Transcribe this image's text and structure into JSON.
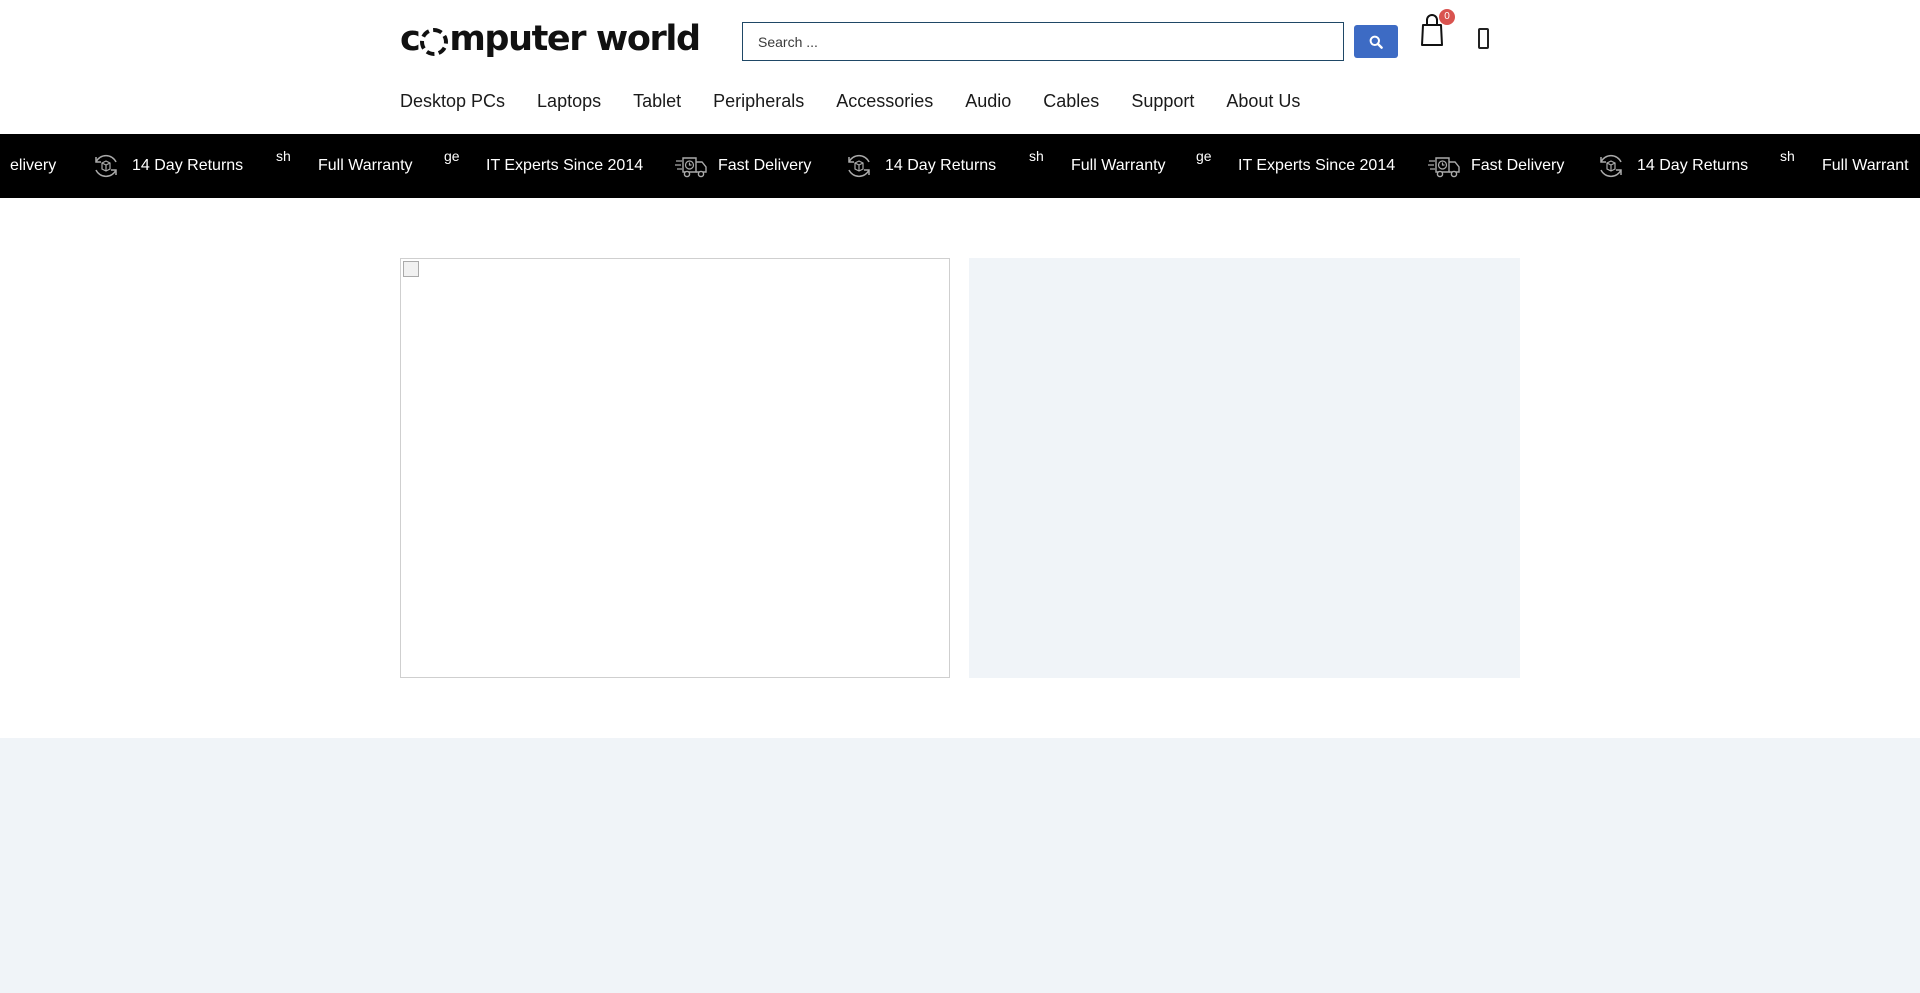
{
  "header": {
    "logo": {
      "before": "c",
      "after": "mputer world"
    },
    "search": {
      "placeholder": "Search ...",
      "value": ""
    },
    "cart": {
      "count": "0"
    }
  },
  "nav": {
    "items": [
      {
        "label": "Desktop PCs"
      },
      {
        "label": "Laptops"
      },
      {
        "label": "Tablet"
      },
      {
        "label": "Peripherals"
      },
      {
        "label": "Accessories"
      },
      {
        "label": "Audio"
      },
      {
        "label": "Cables"
      },
      {
        "label": "Support"
      },
      {
        "label": "About Us"
      }
    ]
  },
  "ticker": {
    "items": [
      {
        "label": "elivery",
        "icon": "none"
      },
      {
        "label": "14 Day Returns",
        "icon": "returns-icon"
      },
      {
        "label": "Full Warranty",
        "icon": "broken-image",
        "alt": "sh"
      },
      {
        "label": "IT Experts Since 2014",
        "icon": "broken-image",
        "alt": "ge"
      },
      {
        "label": "Fast Delivery",
        "icon": "delivery-truck-icon"
      },
      {
        "label": "14 Day Returns",
        "icon": "returns-icon"
      },
      {
        "label": "Full Warranty",
        "icon": "broken-image",
        "alt": "sh"
      },
      {
        "label": "IT Experts Since 2014",
        "icon": "broken-image",
        "alt": "ge"
      },
      {
        "label": "Fast Delivery",
        "icon": "delivery-truck-icon"
      },
      {
        "label": "14 Day Returns",
        "icon": "returns-icon"
      },
      {
        "label": "Full Warrant",
        "icon": "broken-image",
        "alt": "sh"
      }
    ]
  },
  "colors": {
    "search_button": "#3d6bc4",
    "badge": "#d9534f",
    "ticker_bg": "#000000",
    "panel_bg": "#f0f4f8"
  }
}
